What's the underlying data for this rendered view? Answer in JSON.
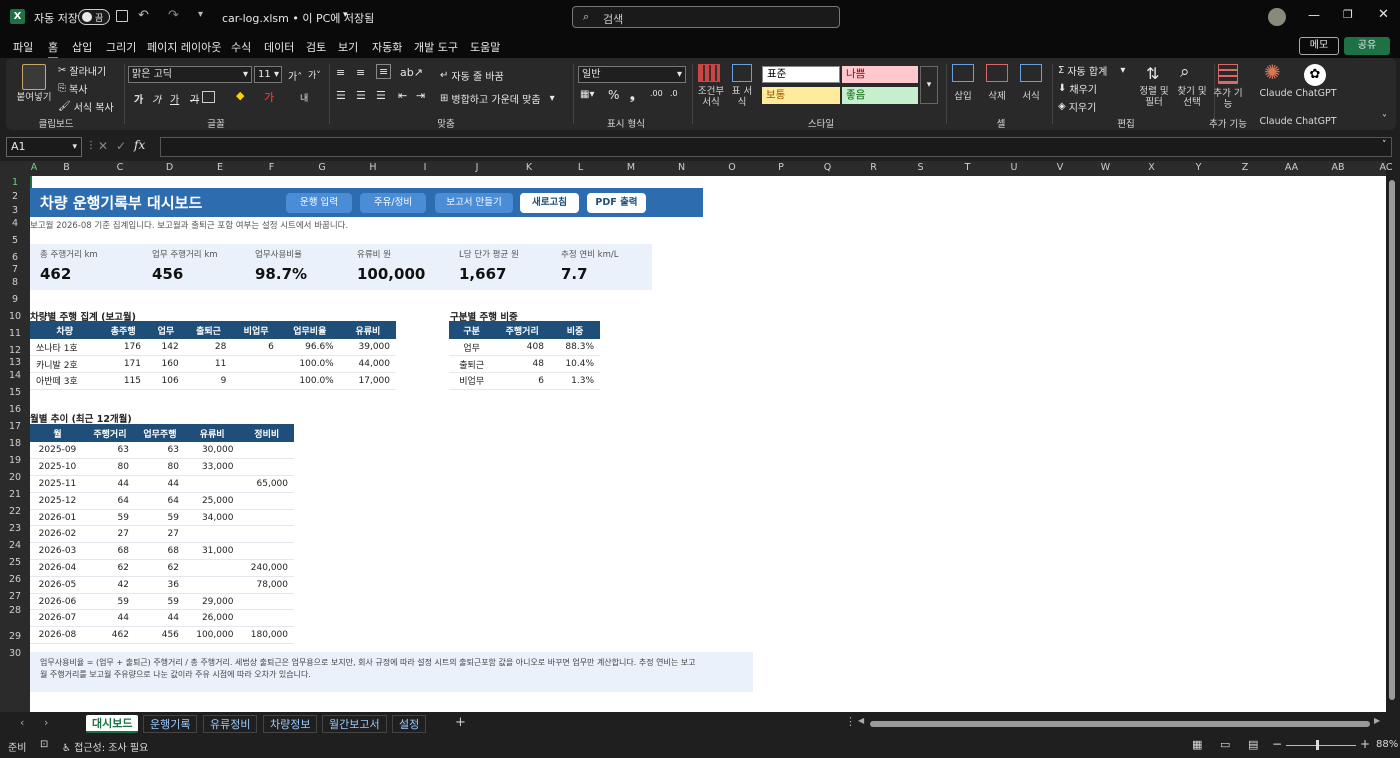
{
  "titlebar": {
    "autosave_label": "자동 저장",
    "toggle_label": "끔",
    "filename": "car-log.xlsm • 이 PC에 저장됨",
    "search_placeholder": "검색"
  },
  "menu": [
    "파일",
    "홈",
    "삽입",
    "그리기",
    "페이지 레이아웃",
    "수식",
    "데이터",
    "검토",
    "보기",
    "자동화",
    "개발 도구",
    "도움말"
  ],
  "menu_right": {
    "memo": "메모",
    "share": "공유"
  },
  "ribbon": {
    "clipboard": {
      "paste": "붙여넣기",
      "cut": "잘라내기",
      "copy": "복사",
      "format_painter": "서식 복사",
      "group": "클립보드"
    },
    "font": {
      "name": "맑은 고딕",
      "size": "11",
      "group": "글꼴"
    },
    "align": {
      "wrap": "자동 줄 바꿈",
      "merge": "병합하고 가운데 맞춤",
      "group": "맞춤"
    },
    "number": {
      "format": "일반",
      "group": "표시 형식"
    },
    "styles": {
      "cond": "조건부 서식",
      "table": "표 서식",
      "normal": "표준",
      "bad": "나쁨",
      "neutral": "보통",
      "good": "좋음",
      "group": "스타일"
    },
    "cells": {
      "insert": "삽입",
      "delete": "삭제",
      "format": "서식",
      "group": "셀"
    },
    "editing": {
      "autosum": "자동 합계",
      "fill": "채우기",
      "clear": "지우기",
      "sort": "정렬 및 필터",
      "find": "찾기 및 선택",
      "group": "편집"
    },
    "addins": {
      "label": "추가 기능",
      "group": "추가 기능"
    },
    "claude": {
      "label": "Claude",
      "group": "Claude"
    },
    "chatgpt": {
      "label": "ChatGPT",
      "group": "ChatGPT"
    }
  },
  "namebox": "A1",
  "columns": [
    "A",
    "B",
    "C",
    "D",
    "E",
    "F",
    "G",
    "H",
    "I",
    "J",
    "K",
    "L",
    "M",
    "N",
    "O",
    "P",
    "Q",
    "R",
    "S",
    "T",
    "U",
    "V",
    "W",
    "X",
    "Y",
    "Z",
    "AA",
    "AB",
    "AC"
  ],
  "rows": [
    "1",
    "2",
    "3",
    "4",
    "5",
    "6",
    "7",
    "8",
    "9",
    "10",
    "11",
    "12",
    "13",
    "14",
    "15",
    "16",
    "17",
    "18",
    "19",
    "20",
    "21",
    "22",
    "23",
    "24",
    "25",
    "26",
    "27",
    "28",
    "29",
    "30"
  ],
  "dash": {
    "title": "차량 운행기록부 대시보드",
    "buttons": [
      "운행 입력",
      "주유/정비",
      "보고서 만들기",
      "새로고침",
      "PDF 출력"
    ],
    "subtitle": "보고월 2026-08 기준 집계입니다. 보고월과 출퇴근 포함 여부는 설정 시트에서 바꿉니다.",
    "kpis": [
      {
        "label": "총 주행거리 km",
        "value": "462"
      },
      {
        "label": "업무 주행거리 km",
        "value": "456"
      },
      {
        "label": "업무사용비율",
        "value": "98.7%"
      },
      {
        "label": "유류비 원",
        "value": "100,000"
      },
      {
        "label": "L당 단가 평균 원",
        "value": "1,667"
      },
      {
        "label": "추정 연비 km/L",
        "value": "7.7"
      }
    ],
    "vehicle_title": "차량별 주행 집계 (보고월)",
    "vehicle_headers": [
      "차량",
      "총주행",
      "업무",
      "출퇴근",
      "비업무",
      "업무비율",
      "유류비"
    ],
    "vehicle_rows": [
      [
        "쏘나타 1호",
        "176",
        "142",
        "28",
        "6",
        "96.6%",
        "39,000"
      ],
      [
        "카니발 2호",
        "171",
        "160",
        "11",
        "",
        "100.0%",
        "44,000"
      ],
      [
        "아반떼 3호",
        "115",
        "106",
        "9",
        "",
        "100.0%",
        "17,000"
      ]
    ],
    "category_title": "구분별 주행 비중",
    "category_headers": [
      "구분",
      "주행거리",
      "비중"
    ],
    "category_rows": [
      [
        "업무",
        "408",
        "88.3%"
      ],
      [
        "출퇴근",
        "48",
        "10.4%"
      ],
      [
        "비업무",
        "6",
        "1.3%"
      ]
    ],
    "monthly_title": "월별 추이 (최근 12개월)",
    "monthly_headers": [
      "월",
      "주행거리",
      "업무주행",
      "유류비",
      "정비비"
    ],
    "monthly_rows": [
      [
        "2025-09",
        "63",
        "63",
        "30,000",
        ""
      ],
      [
        "2025-10",
        "80",
        "80",
        "33,000",
        ""
      ],
      [
        "2025-11",
        "44",
        "44",
        "",
        "65,000"
      ],
      [
        "2025-12",
        "64",
        "64",
        "25,000",
        ""
      ],
      [
        "2026-01",
        "59",
        "59",
        "34,000",
        ""
      ],
      [
        "2026-02",
        "27",
        "27",
        "",
        ""
      ],
      [
        "2026-03",
        "68",
        "68",
        "31,000",
        ""
      ],
      [
        "2026-04",
        "62",
        "62",
        "",
        "240,000"
      ],
      [
        "2026-05",
        "42",
        "36",
        "",
        "78,000"
      ],
      [
        "2026-06",
        "59",
        "59",
        "29,000",
        ""
      ],
      [
        "2026-07",
        "44",
        "44",
        "26,000",
        ""
      ],
      [
        "2026-08",
        "462",
        "456",
        "100,000",
        "180,000"
      ]
    ],
    "note_line1": "업무사용비율 = (업무 + 출퇴근) 주행거리 / 총 주행거리. 세법상 출퇴근은 업무용으로 보지만, 회사 규정에 따라 설정 시트의 출퇴근포함 값을 아니오로 바꾸면 업무만 계산합니다. 추정 연비는 보고",
    "note_line2": "월 주행거리를 보고월 주유량으로 나눈 값이라 주유 시점에 따라 오차가 있습니다."
  },
  "tabs": [
    "대시보드",
    "운행기록",
    "유류정비",
    "차량정보",
    "월간보고서",
    "설정"
  ],
  "status": {
    "ready": "준비",
    "accessibility": "접근성: 조사 필요",
    "zoom": "88%"
  },
  "colors": {
    "header_blue": "#2e6cb0",
    "table_header": "#1f4e79",
    "kpi_bg": "#eaf1fa",
    "accent_green": "#1e7145"
  }
}
